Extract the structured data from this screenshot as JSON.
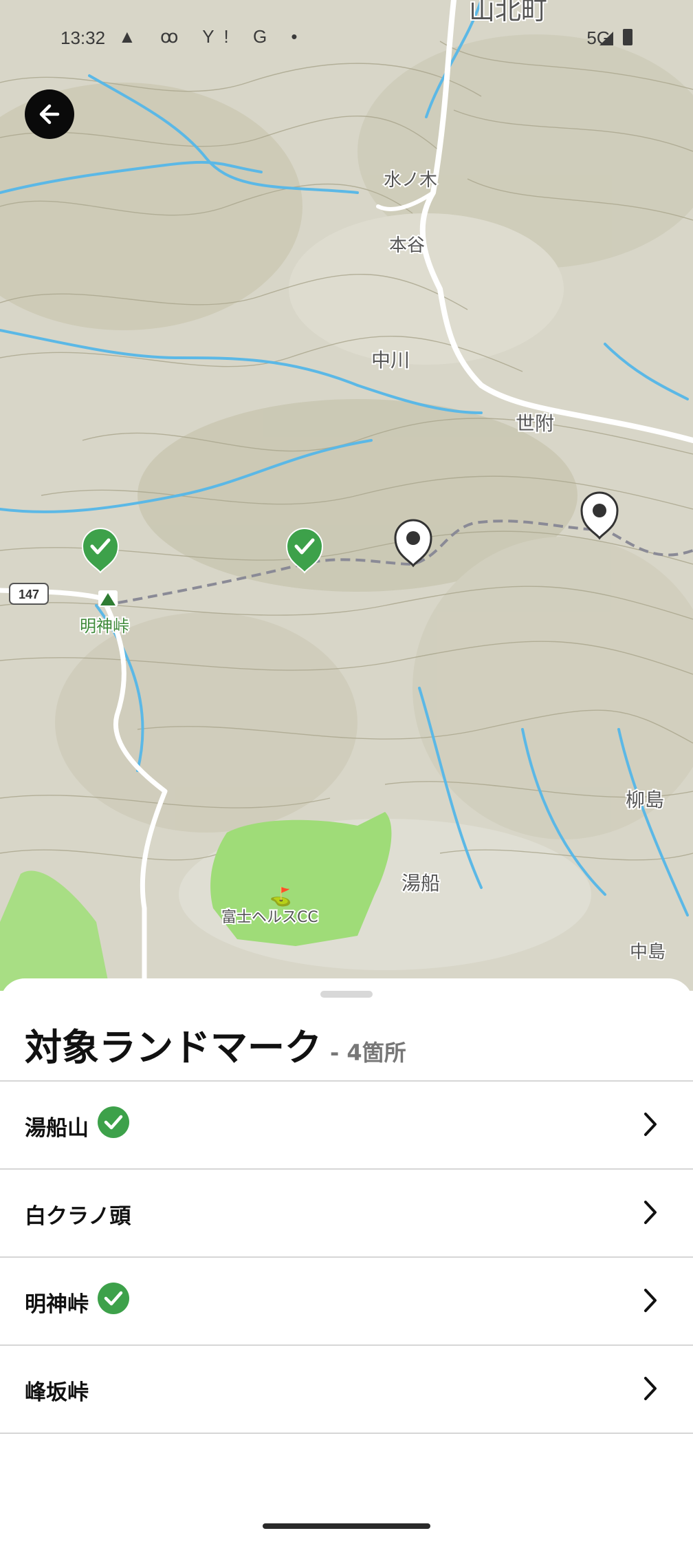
{
  "status_bar": {
    "time": "13:32",
    "notification_icons": "▲ ꝏ Y! G •",
    "network": "5G"
  },
  "map": {
    "route_number": "147",
    "places": [
      {
        "name": "山北町"
      },
      {
        "name": "水ノ木"
      },
      {
        "name": "本谷"
      },
      {
        "name": "中川"
      },
      {
        "name": "世附"
      },
      {
        "name": "明神峠"
      },
      {
        "name": "柳島"
      },
      {
        "name": "湯船"
      },
      {
        "name": "富士ヘルスCC"
      },
      {
        "name": "中島"
      }
    ],
    "pins": [
      {
        "status": "visited",
        "icon": "check-icon"
      },
      {
        "status": "visited",
        "icon": "check-icon"
      },
      {
        "status": "unvisited",
        "icon": "location-pin-icon"
      },
      {
        "status": "unvisited",
        "icon": "location-pin-icon"
      }
    ],
    "colors": {
      "water": "#5bb8e6",
      "road": "#ffffff",
      "trail": "#8a8a96",
      "green": "#9fdc78",
      "check": "#3da14a"
    }
  },
  "sheet": {
    "title": "対象ランドマーク",
    "count": "- 4箇所",
    "items": [
      {
        "label": "湯船山",
        "visited": true
      },
      {
        "label": "白クラノ頭",
        "visited": false
      },
      {
        "label": "明神峠",
        "visited": true
      },
      {
        "label": "峰坂峠",
        "visited": false
      }
    ]
  }
}
